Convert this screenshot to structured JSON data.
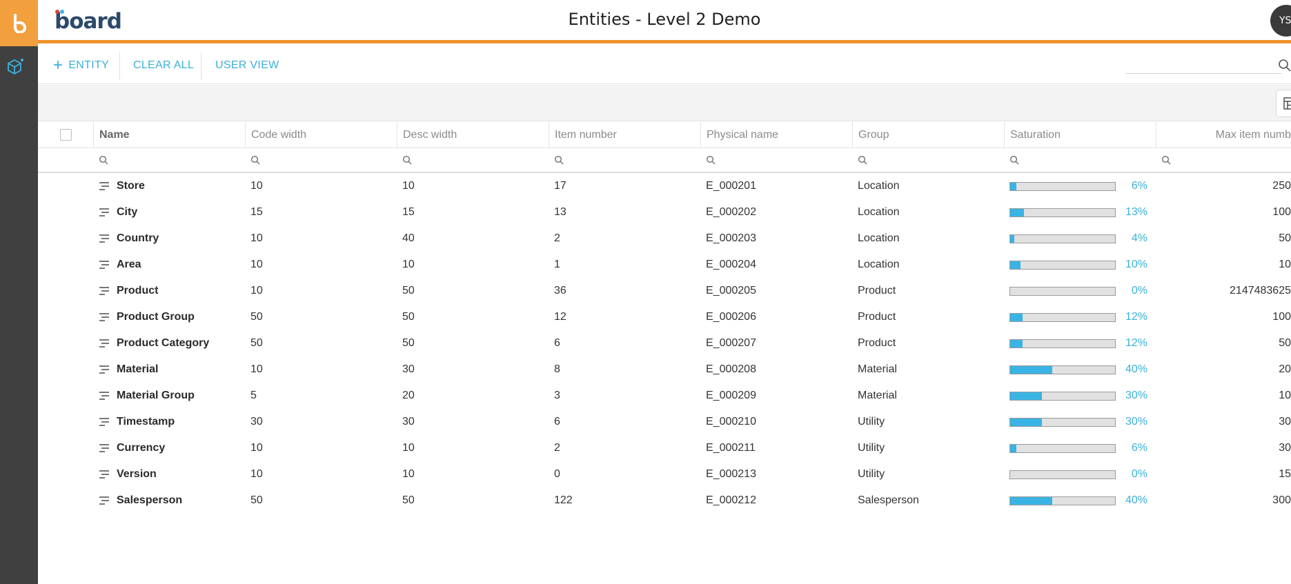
{
  "app": {
    "title": "Entities - Level 2 Demo",
    "brand": "board",
    "user_initials": "YS"
  },
  "toolbar": {
    "entity_label": "ENTITY",
    "clear_all_label": "CLEAR ALL",
    "user_view_label": "USER VIEW",
    "search_placeholder": ""
  },
  "colors": {
    "accent": "#f0932b",
    "link": "#3ab0d8",
    "bar_fill": "#3ab4e4",
    "rail": "#404040"
  },
  "table": {
    "columns": [
      "Name",
      "Code width",
      "Desc width",
      "Item number",
      "Physical name",
      "Group",
      "Saturation",
      "Max item numb"
    ],
    "rows": [
      {
        "name": "Store",
        "code": "10",
        "desc": "10",
        "items": "17",
        "physical": "E_000201",
        "group": "Location",
        "sat": 6,
        "sat_label": "6%",
        "max": "250"
      },
      {
        "name": "City",
        "code": "15",
        "desc": "15",
        "items": "13",
        "physical": "E_000202",
        "group": "Location",
        "sat": 13,
        "sat_label": "13%",
        "max": "100"
      },
      {
        "name": "Country",
        "code": "10",
        "desc": "40",
        "items": "2",
        "physical": "E_000203",
        "group": "Location",
        "sat": 4,
        "sat_label": "4%",
        "max": "50"
      },
      {
        "name": "Area",
        "code": "10",
        "desc": "10",
        "items": "1",
        "physical": "E_000204",
        "group": "Location",
        "sat": 10,
        "sat_label": "10%",
        "max": "10"
      },
      {
        "name": "Product",
        "code": "10",
        "desc": "50",
        "items": "36",
        "physical": "E_000205",
        "group": "Product",
        "sat": 0,
        "sat_label": "0%",
        "max": "2147483625"
      },
      {
        "name": "Product Group",
        "code": "50",
        "desc": "50",
        "items": "12",
        "physical": "E_000206",
        "group": "Product",
        "sat": 12,
        "sat_label": "12%",
        "max": "100"
      },
      {
        "name": "Product Category",
        "code": "50",
        "desc": "50",
        "items": "6",
        "physical": "E_000207",
        "group": "Product",
        "sat": 12,
        "sat_label": "12%",
        "max": "50"
      },
      {
        "name": "Material",
        "code": "10",
        "desc": "30",
        "items": "8",
        "physical": "E_000208",
        "group": "Material",
        "sat": 40,
        "sat_label": "40%",
        "max": "20"
      },
      {
        "name": "Material Group",
        "code": "5",
        "desc": "20",
        "items": "3",
        "physical": "E_000209",
        "group": "Material",
        "sat": 30,
        "sat_label": "30%",
        "max": "10"
      },
      {
        "name": "Timestamp",
        "code": "30",
        "desc": "30",
        "items": "6",
        "physical": "E_000210",
        "group": "Utility",
        "sat": 30,
        "sat_label": "30%",
        "max": "30"
      },
      {
        "name": "Currency",
        "code": "10",
        "desc": "10",
        "items": "2",
        "physical": "E_000211",
        "group": "Utility",
        "sat": 6,
        "sat_label": "6%",
        "max": "30"
      },
      {
        "name": "Version",
        "code": "10",
        "desc": "10",
        "items": "0",
        "physical": "E_000213",
        "group": "Utility",
        "sat": 0,
        "sat_label": "0%",
        "max": "15"
      },
      {
        "name": "Salesperson",
        "code": "50",
        "desc": "50",
        "items": "122",
        "physical": "E_000212",
        "group": "Salesperson",
        "sat": 40,
        "sat_label": "40%",
        "max": "300"
      }
    ]
  }
}
